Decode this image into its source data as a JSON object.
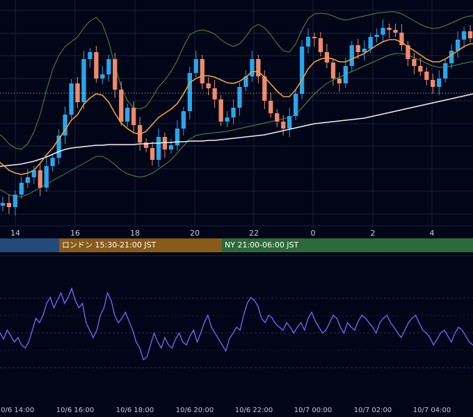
{
  "colors": {
    "background": "#000518",
    "grid": "#1c2438",
    "candle_up": "#2aa6ea",
    "candle_down": "#ef8a6c",
    "ma_fast": "#f4a23a",
    "ma_slow": "#f2f2f2",
    "bollinger": "#4e8f52",
    "oscillator": "#6b72ff",
    "tokyo_session": "#234a7a",
    "london_session": "#8a5a18",
    "ny_session": "#2c6a3c"
  },
  "sessions": [
    {
      "id": "tokyo",
      "label": ""
    },
    {
      "id": "london",
      "label": "ロンドン 15:30-21:00 JST"
    },
    {
      "id": "ny",
      "label": "NY 21:00-06:00 JST"
    }
  ],
  "price_axis_ticks": [
    "14",
    "16",
    "18",
    "20",
    "22",
    "0",
    "2",
    "4"
  ],
  "oscillator_axis_ticks": [
    "10/6 14:00",
    "10/6 16:00",
    "10/6 18:00",
    "10/6 20:00",
    "10/6 22:00",
    "10/7 00:00",
    "10/7 02:00",
    "10/7 04:00"
  ],
  "chart_data": [
    {
      "type": "candlestick",
      "title": "",
      "x_labels": [
        "14",
        "16",
        "18",
        "20",
        "22",
        "0",
        "2",
        "4"
      ],
      "grid": true,
      "overlays": [
        "moving-average-fast",
        "moving-average-slow",
        "bollinger-bands",
        "horizontal-dotted-line"
      ],
      "series": [
        {
          "role": "close",
          "values": [
            29,
            33,
            27,
            45,
            62,
            70,
            80,
            55,
            86,
            98,
            130,
            160,
            205,
            178,
            240,
            250,
            212,
            218,
            240,
            196,
            150,
            170,
            145,
            120,
            112,
            95,
            128,
            110,
            116,
            140,
            165,
            220,
            240,
            205,
            198,
            182,
            150,
            156,
            170,
            200,
            215,
            240,
            215,
            180,
            162,
            150,
            140,
            158,
            190,
            258,
            272,
            270,
            250,
            235,
            212,
            205,
            230,
            260,
            250,
            255,
            272,
            275,
            285,
            282,
            278,
            260,
            240,
            230,
            222,
            210,
            200,
            212,
            234,
            252,
            268,
            280,
            270,
            262
          ]
        },
        {
          "role": "ma_fast",
          "values": [
            95,
            88,
            80,
            76,
            74,
            76,
            80,
            90,
            102,
            112,
            125,
            138,
            152,
            160,
            175,
            184,
            190,
            188,
            178,
            162,
            148,
            140,
            134,
            132,
            136,
            146,
            156,
            162,
            168,
            176,
            190,
            206,
            212,
            216,
            216,
            214,
            210,
            206,
            205,
            208,
            214,
            222,
            222,
            214,
            204,
            194,
            186,
            186,
            196,
            210,
            226,
            236,
            240,
            242,
            240,
            236,
            236,
            240,
            244,
            248,
            254,
            260,
            265,
            268,
            268,
            264,
            258,
            252,
            246,
            240,
            236,
            236,
            240,
            246,
            252,
            258,
            262,
            262
          ]
        },
        {
          "role": "ma_slow",
          "values": [
            85,
            86,
            87,
            88,
            89,
            91,
            93,
            96,
            99,
            103,
            107,
            110,
            112,
            113,
            114,
            115,
            116,
            116,
            117,
            117,
            117,
            117,
            117,
            118,
            118,
            119,
            119,
            120,
            120,
            121,
            121,
            122,
            122,
            122,
            123,
            123,
            124,
            125,
            126,
            127,
            128,
            129,
            130,
            131,
            133,
            135,
            137,
            139,
            141,
            143,
            145,
            147,
            148,
            149,
            150,
            151,
            152,
            153,
            154,
            155,
            157,
            159,
            161,
            163,
            165,
            167,
            169,
            171,
            173,
            175,
            177,
            179,
            181,
            183,
            185,
            187,
            189,
            191
          ]
        },
        {
          "role": "bollinger_upper",
          "values": [
            135,
            128,
            118,
            112,
            110,
            118,
            135,
            160,
            195,
            225,
            245,
            258,
            265,
            272,
            285,
            295,
            300,
            290,
            265,
            230,
            200,
            180,
            170,
            168,
            172,
            185,
            200,
            210,
            222,
            238,
            258,
            275,
            280,
            282,
            280,
            276,
            268,
            262,
            258,
            262,
            272,
            285,
            290,
            285,
            275,
            262,
            252,
            250,
            262,
            282,
            298,
            305,
            306,
            305,
            302,
            298,
            296,
            298,
            300,
            302,
            304,
            306,
            307,
            308,
            308,
            305,
            300,
            295,
            290,
            286,
            284,
            285,
            288,
            292,
            296,
            300,
            302,
            302
          ]
        },
        {
          "role": "bollinger_lower",
          "values": [
            55,
            50,
            45,
            42,
            42,
            45,
            50,
            55,
            60,
            65,
            70,
            75,
            80,
            85,
            90,
            95,
            100,
            100,
            95,
            88,
            80,
            75,
            72,
            70,
            72,
            76,
            82,
            88,
            95,
            105,
            115,
            125,
            130,
            132,
            133,
            134,
            135,
            136,
            138,
            140,
            142,
            144,
            146,
            148,
            150,
            152,
            154,
            156,
            160,
            170,
            180,
            190,
            198,
            205,
            210,
            214,
            218,
            222,
            226,
            230,
            234,
            238,
            242,
            246,
            248,
            248,
            246,
            242,
            238,
            234,
            230,
            228,
            228,
            230,
            232,
            234,
            236,
            236
          ]
        },
        {
          "role": "reference_line",
          "values": [
            191
          ]
        }
      ]
    },
    {
      "type": "line",
      "title": "",
      "x_labels": [
        "10/6 14:00",
        "10/6 16:00",
        "10/6 18:00",
        "10/6 20:00",
        "10/6 22:00",
        "10/7 00:00",
        "10/7 02:00",
        "10/7 04:00"
      ],
      "grid": true,
      "series": [
        {
          "role": "oscillator",
          "values": [
            45,
            48,
            44,
            50,
            46,
            42,
            45,
            40,
            38,
            42,
            50,
            58,
            55,
            60,
            68,
            72,
            65,
            70,
            75,
            68,
            72,
            78,
            70,
            65,
            68,
            55,
            50,
            45,
            50,
            60,
            65,
            75,
            70,
            60,
            55,
            58,
            62,
            56,
            50,
            42,
            38,
            30,
            32,
            40,
            48,
            42,
            38,
            45,
            40,
            38,
            44,
            48,
            42,
            40,
            46,
            50,
            42,
            48,
            55,
            60,
            52,
            48,
            44,
            40,
            36,
            44,
            48,
            52,
            50,
            60,
            68,
            72,
            70,
            66,
            58,
            55,
            60,
            58,
            54,
            52,
            50,
            55,
            52,
            48,
            52,
            55,
            50,
            58,
            62,
            56,
            52,
            48,
            50,
            55,
            60,
            58,
            52,
            48,
            55,
            52,
            50,
            56,
            60,
            58,
            55,
            52,
            48,
            55,
            58,
            60,
            55,
            52,
            48,
            45,
            50,
            55,
            58,
            60,
            55,
            50,
            48,
            45,
            40,
            44,
            48,
            50,
            46,
            42,
            48,
            52,
            50,
            46,
            42,
            40,
            38
          ]
        }
      ]
    }
  ]
}
